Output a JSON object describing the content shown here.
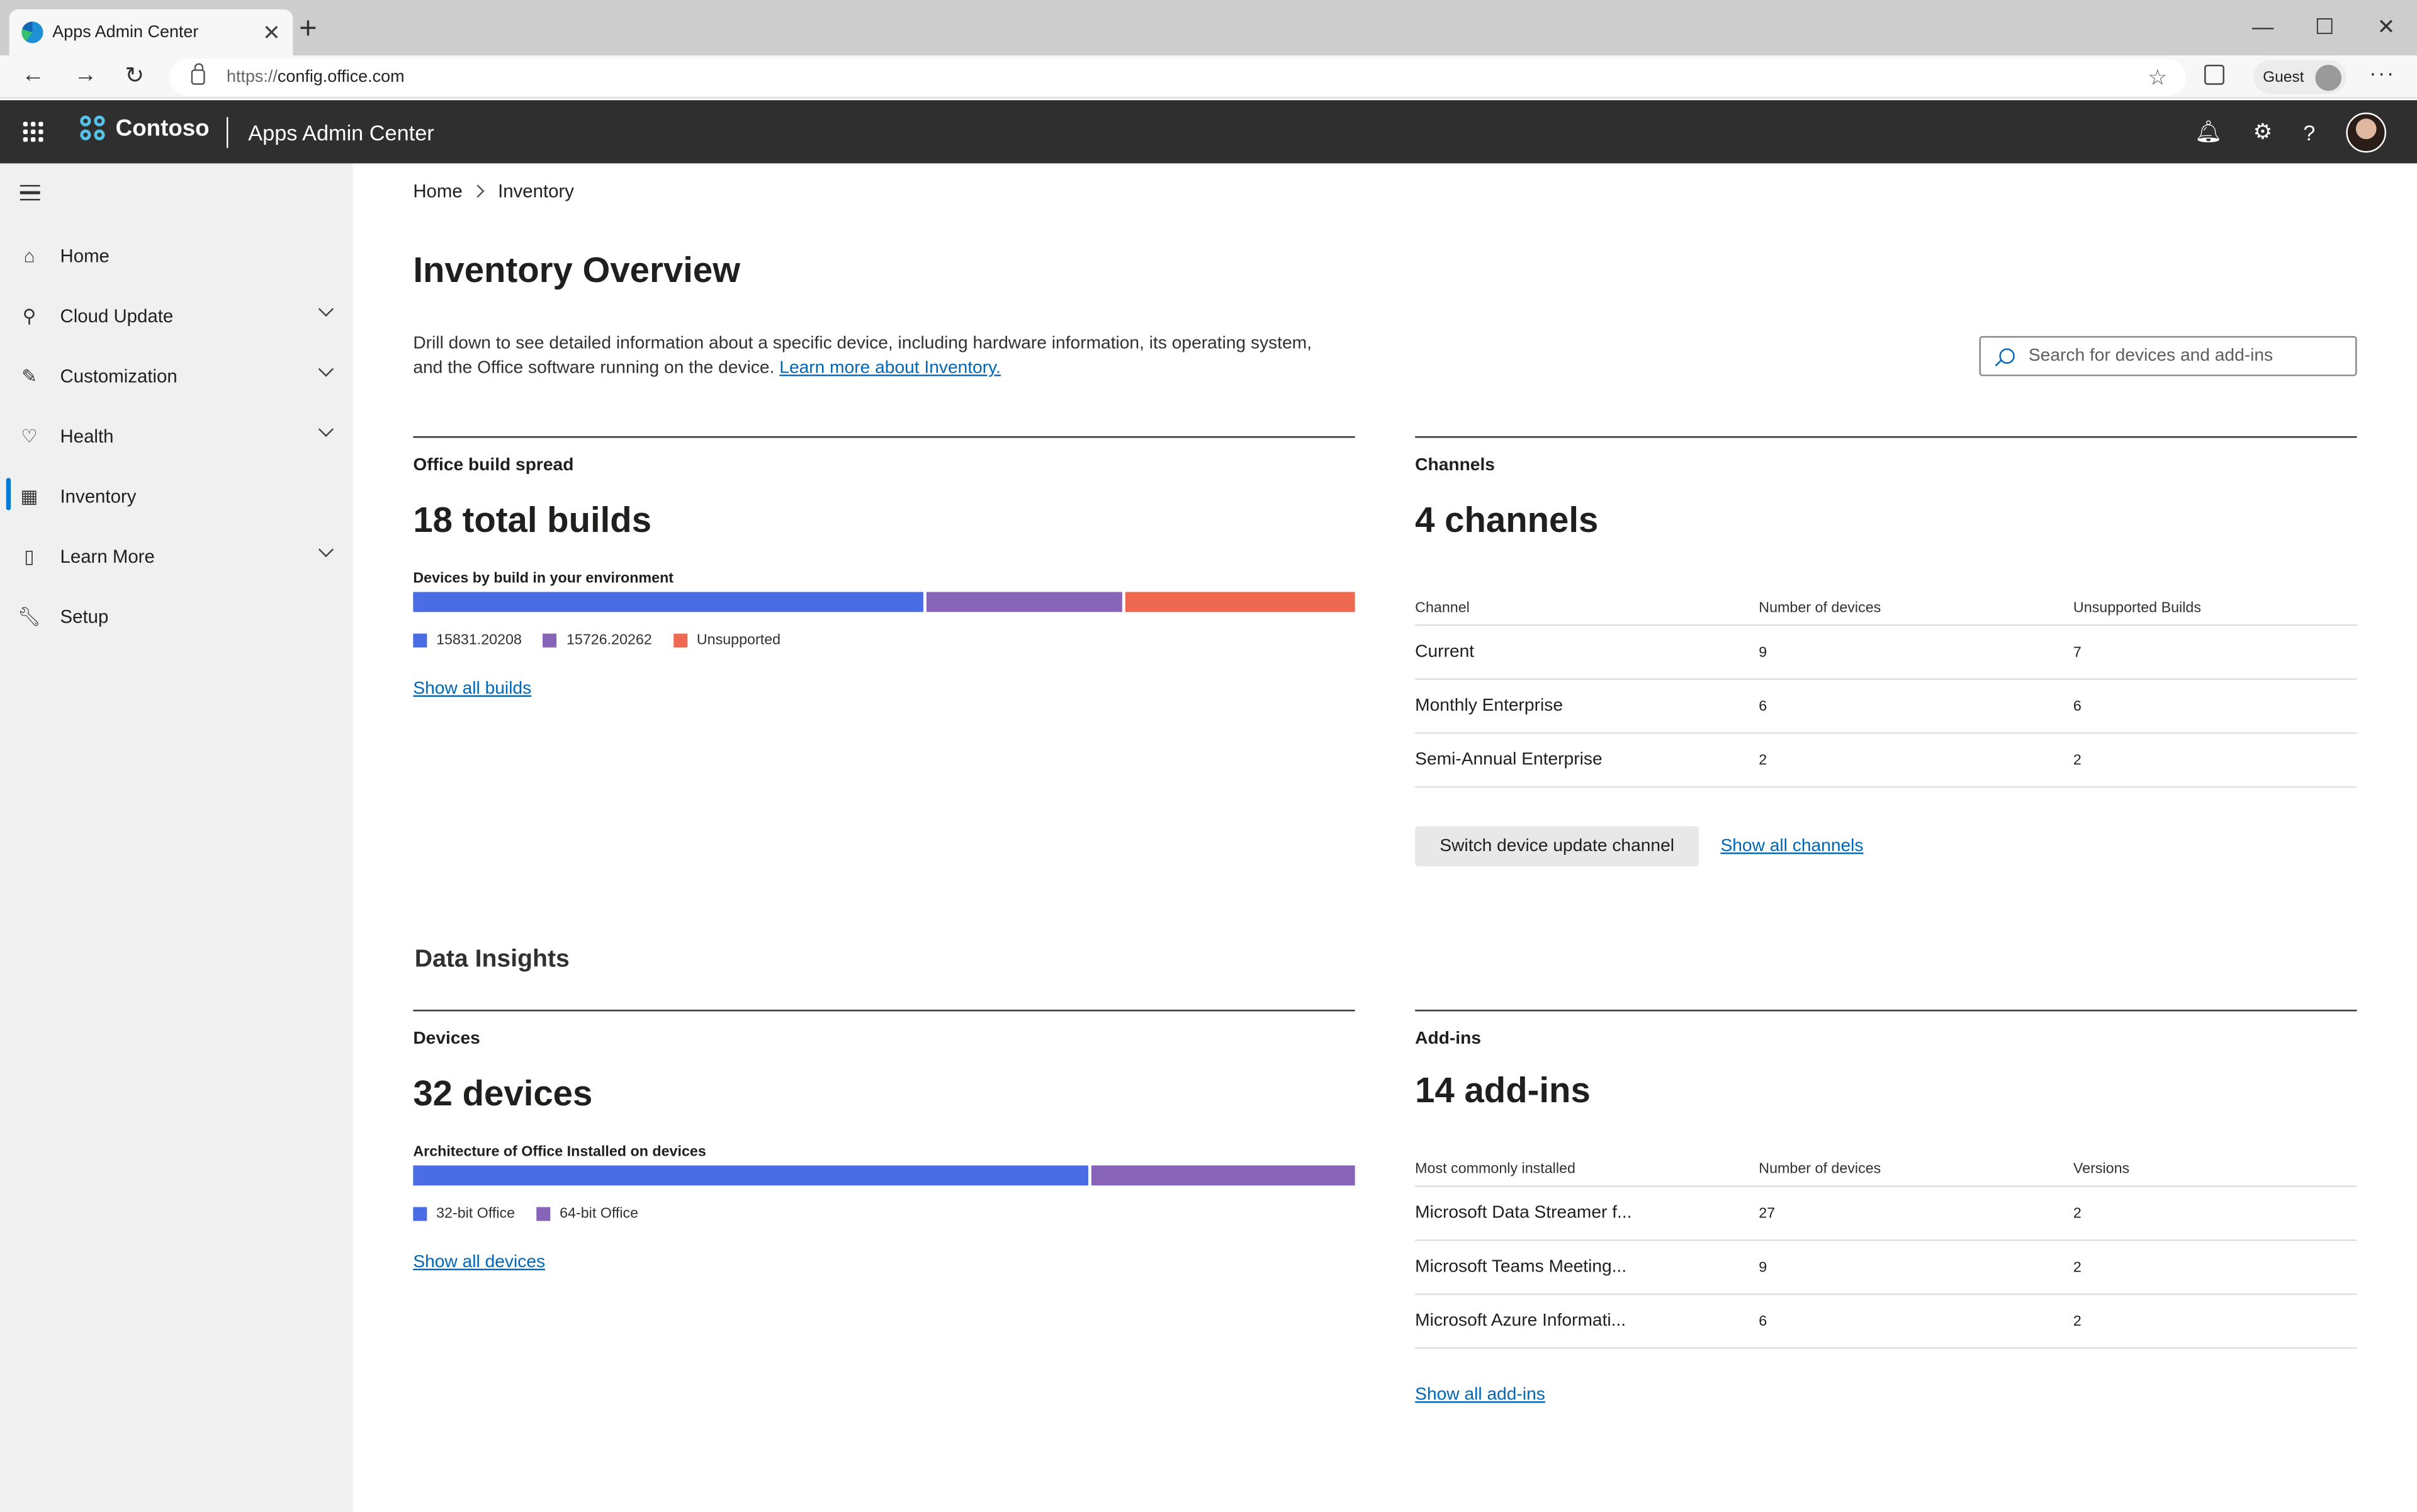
{
  "browser": {
    "tab_title": "Apps Admin Center",
    "url_protocol": "https://",
    "url_host": "config.office.com",
    "profile_label": "Guest"
  },
  "app": {
    "brand": "Contoso",
    "title": "Apps Admin Center"
  },
  "sidebar": {
    "items": [
      {
        "label": "Home",
        "icon": "home-icon"
      },
      {
        "label": "Cloud Update",
        "icon": "cloud-update-icon"
      },
      {
        "label": "Customization",
        "icon": "customization-icon"
      },
      {
        "label": "Health",
        "icon": "health-icon"
      },
      {
        "label": "Inventory",
        "icon": "inventory-icon"
      },
      {
        "label": "Learn More",
        "icon": "book-icon"
      },
      {
        "label": "Setup",
        "icon": "wrench-icon"
      }
    ]
  },
  "breadcrumb": {
    "home": "Home",
    "current": "Inventory"
  },
  "page": {
    "title": "Inventory Overview",
    "description": "Drill down to see detailed information about a specific device, including hardware information, its operating system, and the Office software running on the device.",
    "learn_more": "Learn more about Inventory.",
    "search_placeholder": "Search for devices and add-ins"
  },
  "builds": {
    "label": "Office build spread",
    "total": "18 total builds",
    "bar_label": "Devices by build in your environment",
    "segments": [
      {
        "name": "15831.20208",
        "share": 0.545,
        "color": "#4a6de5"
      },
      {
        "name": "15726.20262",
        "share": 0.21,
        "color": "#8764b8"
      },
      {
        "name": "Unsupported",
        "share": 0.245,
        "color": "#ef6950"
      }
    ],
    "link": "Show all builds"
  },
  "channels": {
    "label": "Channels",
    "total": "4 channels",
    "headers": [
      "Channel",
      "Number of devices",
      "Unsupported Builds"
    ],
    "rows": [
      [
        "Current",
        "9",
        "7"
      ],
      [
        "Monthly Enterprise",
        "6",
        "6"
      ],
      [
        "Semi-Annual Enterprise",
        "2",
        "2"
      ]
    ],
    "button": "Switch device update channel",
    "link": "Show all channels"
  },
  "insights": {
    "title": "Data Insights"
  },
  "devices": {
    "label": "Devices",
    "total": "32 devices",
    "bar_label": "Architecture of Office Installed on devices",
    "segments": [
      {
        "name": "32-bit Office",
        "share": 0.72,
        "color": "#4a6de5"
      },
      {
        "name": "64-bit Office",
        "share": 0.28,
        "color": "#8764b8"
      }
    ],
    "link": "Show all devices"
  },
  "addins": {
    "label": "Add-ins",
    "total": "14 add-ins",
    "headers": [
      "Most commonly installed",
      "Number of devices",
      "Versions"
    ],
    "rows": [
      [
        "Microsoft Data Streamer f...",
        "27",
        "2"
      ],
      [
        "Microsoft Teams Meeting...",
        "9",
        "2"
      ],
      [
        "Microsoft Azure Informati...",
        "6",
        "2"
      ]
    ],
    "link": "Show all add-ins"
  }
}
